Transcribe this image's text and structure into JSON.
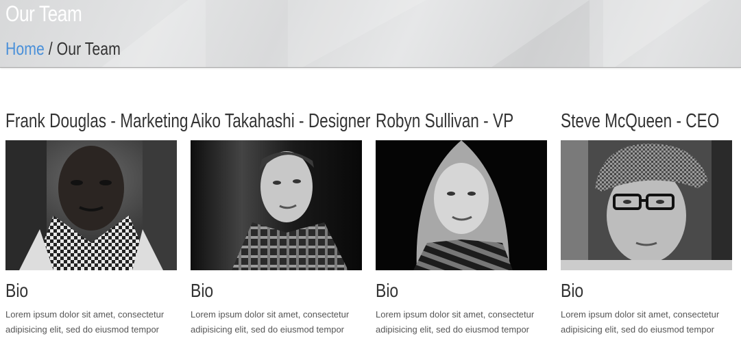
{
  "header": {
    "title": "Our Team",
    "breadcrumb": {
      "home": "Home",
      "separator": "/",
      "current": "Our Team"
    }
  },
  "members": [
    {
      "name": "Frank Douglas - Marketing",
      "photo": "portrait-photo",
      "bio_title": "Bio",
      "bio_text": "Lorem ipsum dolor sit amet, consectetur adipisicing elit, sed do eiusmod tempor"
    },
    {
      "name": "Aiko Takahashi - Designer",
      "photo": "portrait-photo",
      "bio_title": "Bio",
      "bio_text": "Lorem ipsum dolor sit amet, consectetur adipisicing elit, sed do eiusmod tempor"
    },
    {
      "name": "Robyn Sullivan - VP",
      "photo": "portrait-photo",
      "bio_title": "Bio",
      "bio_text": "Lorem ipsum dolor sit amet, consectetur adipisicing elit, sed do eiusmod tempor"
    },
    {
      "name": "Steve McQueen - CEO",
      "photo": "portrait-photo",
      "bio_title": "Bio",
      "bio_text": "Lorem ipsum dolor sit amet, consectetur adipisicing elit, sed do eiusmod tempor"
    }
  ],
  "colors": {
    "link": "#4a90d9",
    "heading": "#333333",
    "body_text": "#555555",
    "header_bg": "#dcdddf"
  }
}
